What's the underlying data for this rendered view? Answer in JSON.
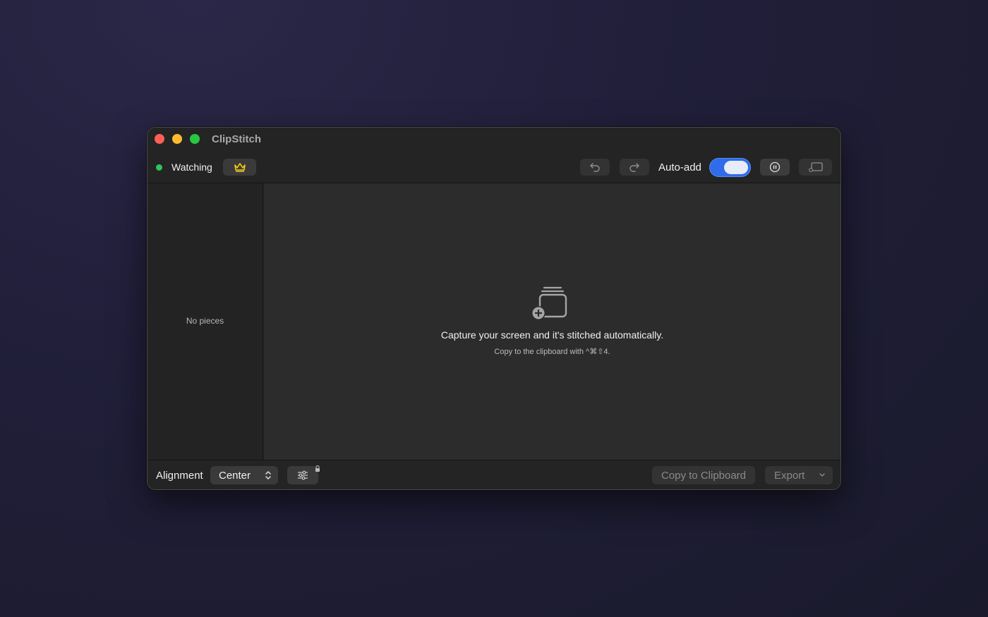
{
  "window": {
    "title": "ClipStitch"
  },
  "toolbar": {
    "status_label": "Watching",
    "status_color": "#2fc55b",
    "crown_icon": "crown-icon",
    "undo_icon": "undo-icon",
    "redo_icon": "redo-icon",
    "auto_add_label": "Auto-add",
    "auto_add_enabled": true,
    "pause_icon": "pause-icon",
    "screen_icon": "screen-capture-icon"
  },
  "sidebar": {
    "empty_label": "No pieces"
  },
  "canvas": {
    "empty_icon": "stack-add-icon",
    "empty_title": "Capture your screen and it's stitched automatically.",
    "empty_subtitle": "Copy to the clipboard with ^⌘⇧4."
  },
  "bottombar": {
    "alignment_label": "Alignment",
    "alignment_value": "Center",
    "settings_icon": "sliders-icon",
    "copy_label": "Copy to Clipboard",
    "export_label": "Export"
  },
  "colors": {
    "accent": "#2f6bea",
    "crown": "#f5c518"
  }
}
